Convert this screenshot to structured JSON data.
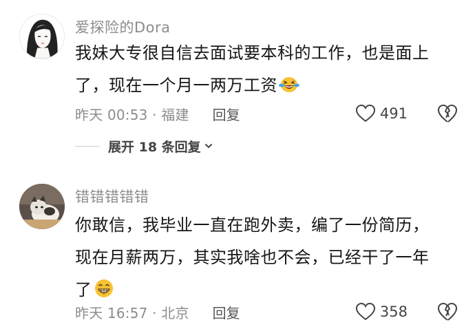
{
  "comments": [
    {
      "username": "爱探险的Dora",
      "text_line1": "我妹大专很自信去面试要本科的工作，也是面上",
      "text_line2": "了，现在一个月一两万工资",
      "emoji": "laughing-tears-icon",
      "time": "昨天 00:53 · 福建",
      "reply_label": "回复",
      "likes": "491",
      "expand_label": "展开 18 条回复"
    },
    {
      "username": "错错错错错",
      "text_line1": "你敢信，我毕业一直在跑外卖，编了一份简历，",
      "text_line2": "现在月薪两万，其实我啥也不会，已经干了一年",
      "text_line3": "了",
      "emoji": "grinning-icon",
      "time": "昨天 16:57 · 北京",
      "reply_label": "回复",
      "likes": "358"
    }
  ],
  "colors": {
    "meta_text": "#8c8c8c",
    "body_text": "#161616",
    "emoji_yellow": "#f7c233",
    "tears_blue": "#4aa3e8"
  }
}
